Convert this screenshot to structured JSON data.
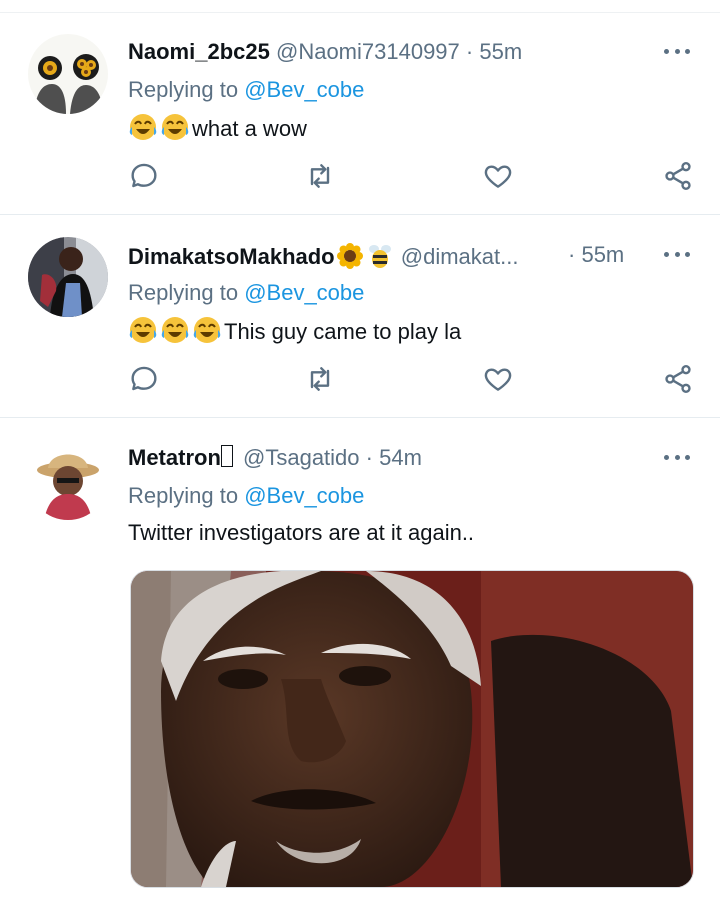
{
  "tweets": [
    {
      "name": "Naomi_2bc25",
      "handle": "@Naomi73140997",
      "dot": "·",
      "time": "55m",
      "reply_prefix": "Replying to",
      "reply_to": "@Bev_cobe",
      "emoji_count": 2,
      "text": "what a wow"
    },
    {
      "name": "DimakatsoMakhado",
      "handle": "@dimakat...",
      "dot": "·",
      "time": "55m",
      "reply_prefix": "Replying to",
      "reply_to": "@Bev_cobe",
      "emoji_count": 3,
      "text": "This guy came to play la"
    },
    {
      "name": "Metatron",
      "handle": "@Tsagatido",
      "dot": "·",
      "time": "54m",
      "reply_prefix": "Replying to",
      "reply_to": "@Bev_cobe",
      "emoji_count": 0,
      "text": "Twitter investigators are at it again.."
    }
  ],
  "icons": {
    "reply": "comment-icon",
    "retweet": "retweet-icon",
    "like": "heart-icon",
    "share": "share-icon",
    "more": "more-icon"
  },
  "colors": {
    "link": "#1b95e0",
    "muted": "#5b7083",
    "text": "#0f1419"
  }
}
